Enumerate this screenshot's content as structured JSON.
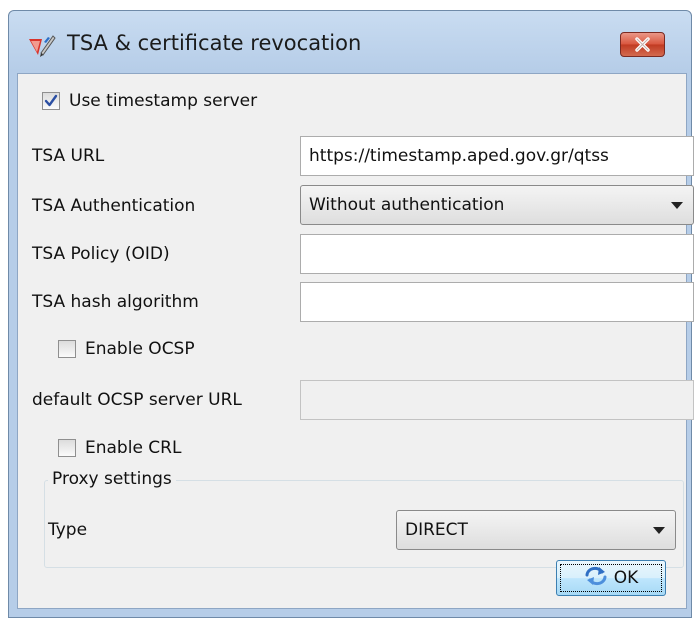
{
  "window": {
    "title": "TSA & certificate revocation",
    "icon": "pen-certificate-icon",
    "close_icon": "close-icon"
  },
  "form": {
    "use_timestamp": {
      "label": "Use timestamp server",
      "checked": true
    },
    "tsa_url": {
      "label": "TSA URL",
      "value": "https://timestamp.aped.gov.gr/qtss"
    },
    "tsa_auth": {
      "label": "TSA Authentication",
      "value": "Without authentication"
    },
    "tsa_policy": {
      "label": "TSA Policy (OID)",
      "value": ""
    },
    "tsa_hash": {
      "label": "TSA hash algorithm",
      "value": ""
    },
    "enable_ocsp": {
      "label": "Enable OCSP",
      "checked": false
    },
    "ocsp_url": {
      "label": "default OCSP server URL",
      "value": ""
    },
    "enable_crl": {
      "label": "Enable CRL",
      "checked": false
    }
  },
  "proxy": {
    "title": "Proxy settings",
    "type_label": "Type",
    "type_value": "DIRECT"
  },
  "footer": {
    "ok_label": "OK",
    "ok_icon": "refresh-arrow-icon"
  },
  "colors": {
    "titlebar": "#b6cde8",
    "client_bg": "#f0f0f0",
    "close_button": "#c03a22",
    "check_mark": "#2b4fa3"
  }
}
